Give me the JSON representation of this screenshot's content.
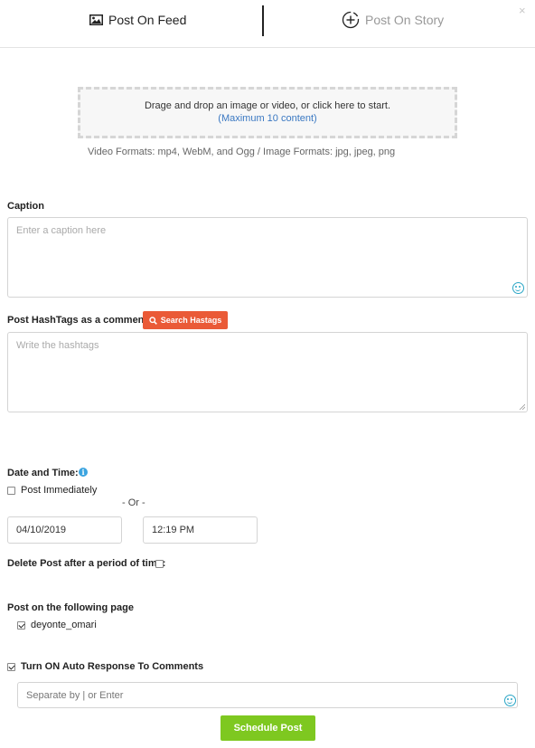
{
  "tabs": {
    "feed_label": "Post On Feed",
    "story_label": "Post On Story",
    "close_symbol": "×"
  },
  "upload": {
    "prompt": "Drage and drop an image or video, or click here to start.",
    "limit": "(Maximum 10 content)",
    "formats": "Video Formats: mp4, WebM, and Ogg / Image Formats: jpg, jpeg, png"
  },
  "caption": {
    "label": "Caption",
    "placeholder": "Enter a caption here"
  },
  "hashtags": {
    "label": "Post HashTags as a comment",
    "search_button": "Search Hastags",
    "placeholder": "Write the hashtags"
  },
  "schedule": {
    "label": "Date and Time:",
    "info_symbol": "i",
    "post_immediately": "Post Immediately",
    "post_immediately_checked": false,
    "or_text": "- Or -",
    "date": "04/10/2019",
    "time": "12:19 PM"
  },
  "delete_post": {
    "label": "Delete Post after a period of time:",
    "checked": false
  },
  "pages": {
    "label": "Post on the following page",
    "items": [
      {
        "name": "deyonte_omari",
        "checked": true
      }
    ]
  },
  "auto_response": {
    "label": "Turn ON Auto Response To Comments",
    "checked": true,
    "placeholder": "Separate by | or Enter"
  },
  "submit": {
    "label": "Schedule Post"
  },
  "colors": {
    "search_button": "#ea5a37",
    "schedule_button": "#7ec820",
    "link_blue": "#3a78c2",
    "emoji_teal": "#2aa6c6",
    "info_blue": "#3ba4e0"
  },
  "icons": {
    "feed_tab": "image-icon",
    "story_tab": "circle-plus-icon",
    "search_button": "search-icon",
    "caption_emoji": "emoji-icon",
    "auto_response_emoji": "emoji-icon",
    "info": "info-icon"
  }
}
